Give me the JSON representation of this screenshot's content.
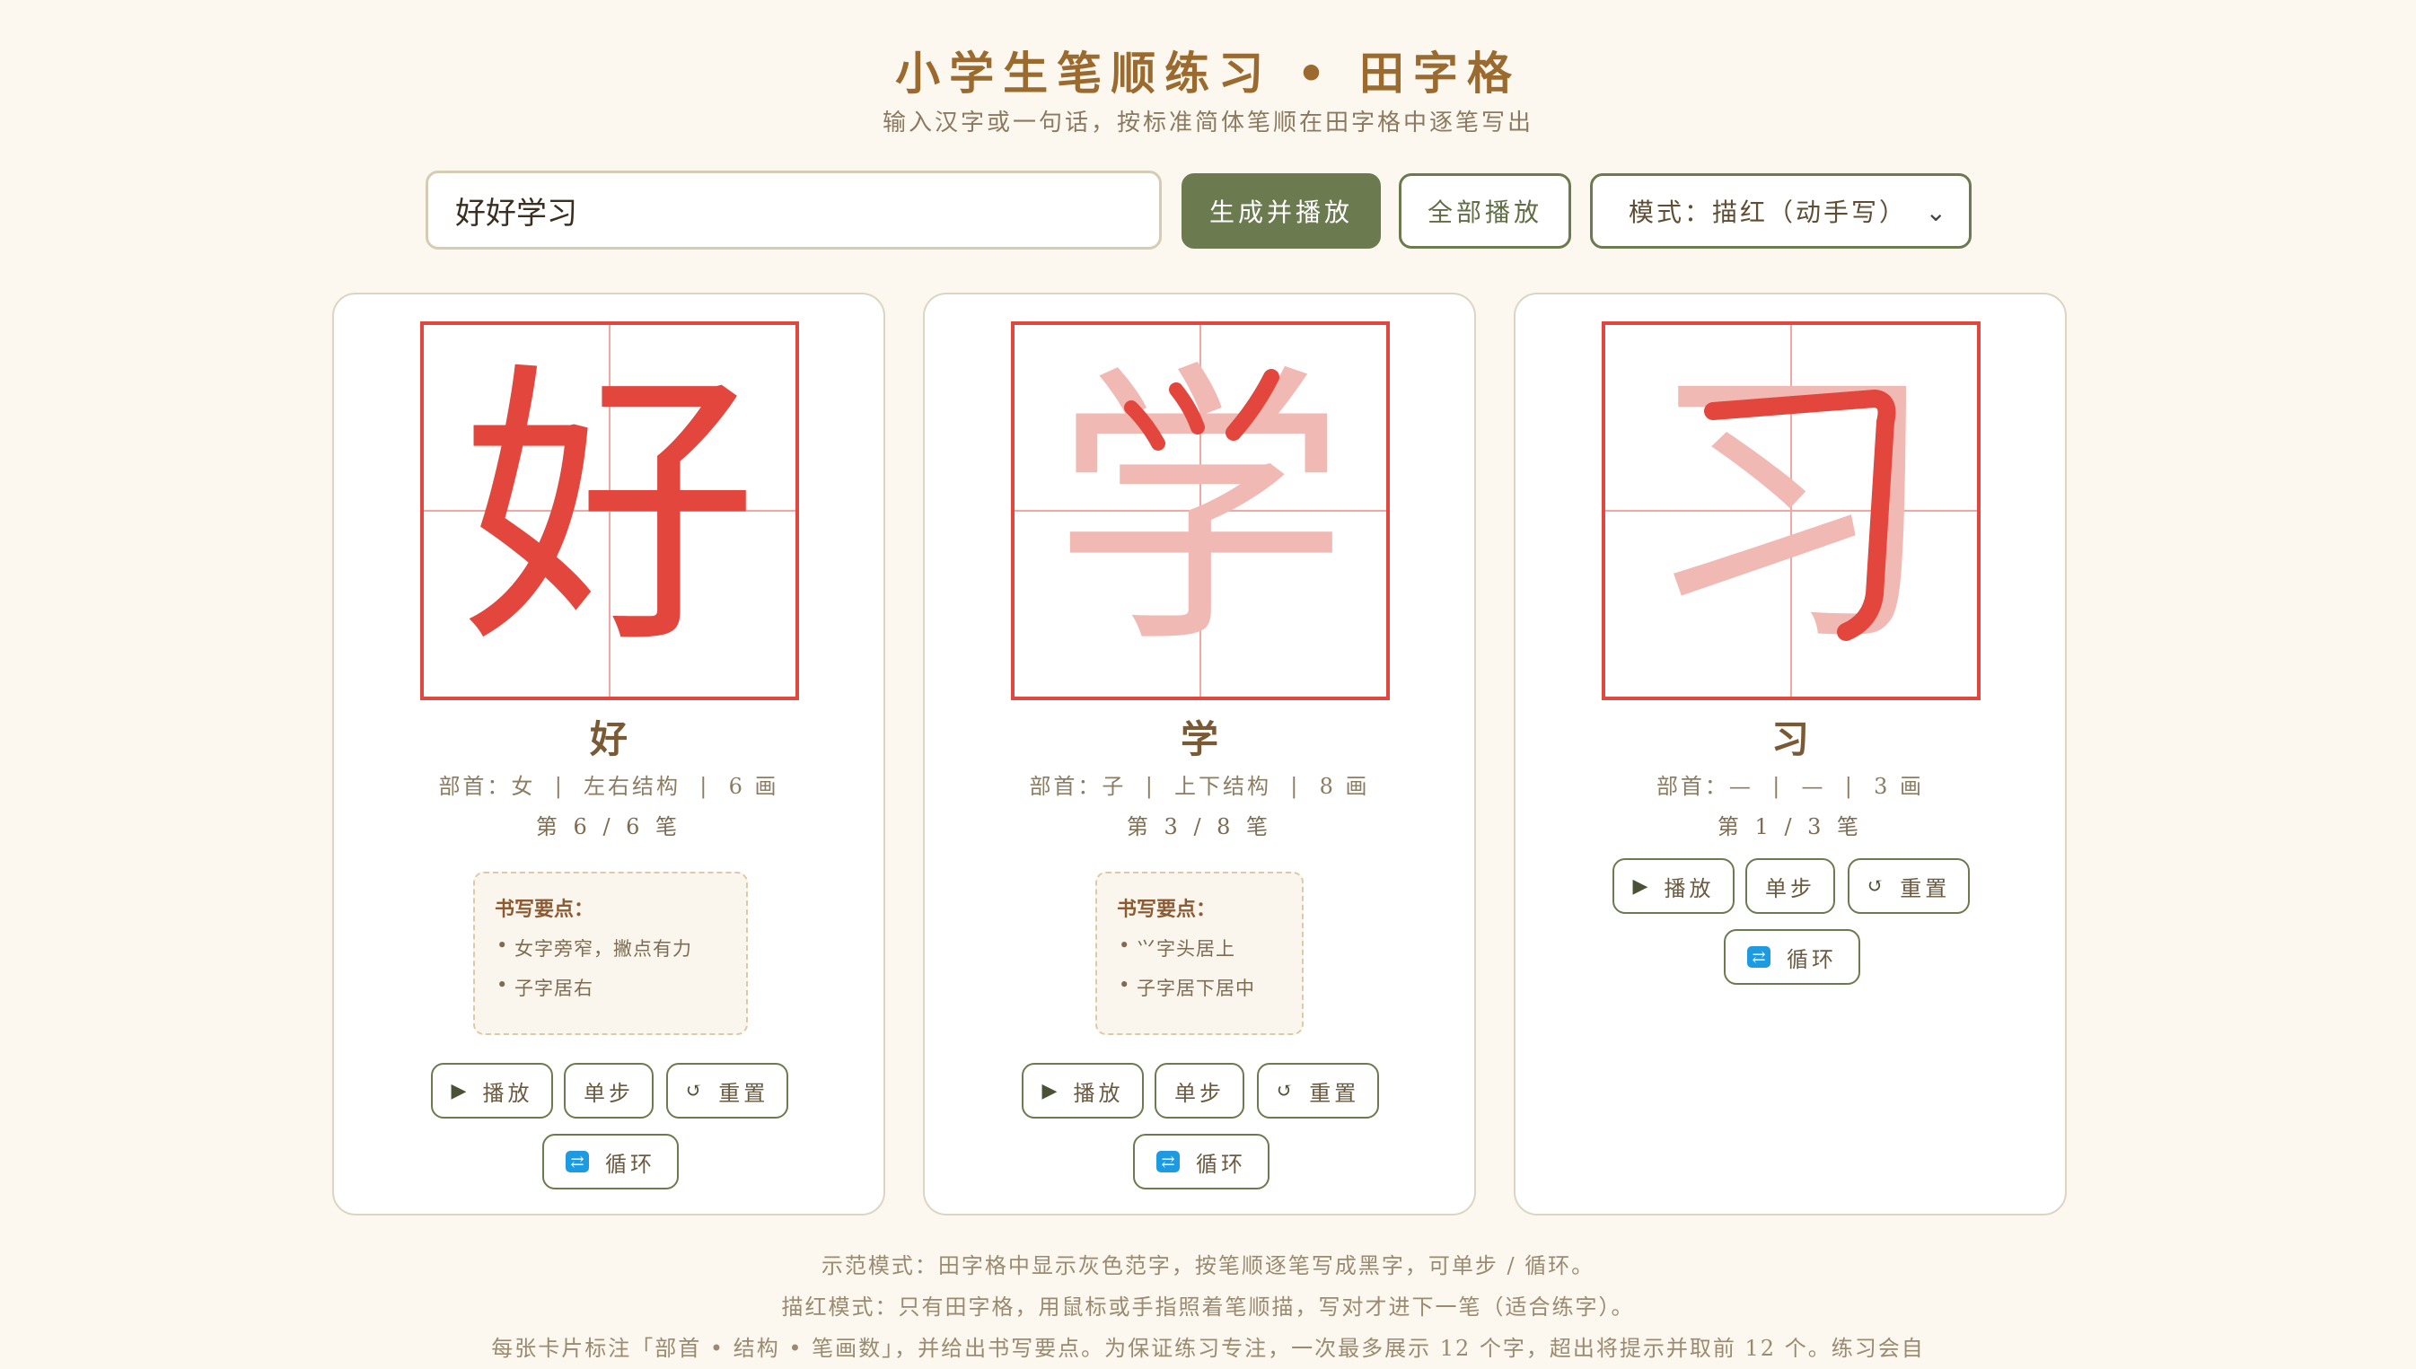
{
  "header": {
    "title": "小学生笔顺练习 • 田字格",
    "subtitle": "输入汉字或一句话，按标准简体笔顺在田字格中逐笔写出"
  },
  "controls": {
    "input_value": "好好学习",
    "generate_label": "生成并播放",
    "play_all_label": "全部播放",
    "mode_label": "模式：描红（动手写）"
  },
  "cards": [
    {
      "char": "好",
      "info": "部首：女  |  左右结构  |  6 画",
      "progress": "第 6 / 6 笔",
      "tips_title": "书写要点：",
      "tips": [
        "女字旁窄，撇点有力",
        "子字居右"
      ],
      "play_label": "播放",
      "step_label": "单步",
      "reset_label": "重置",
      "loop_label": "循环"
    },
    {
      "char": "学",
      "info": "部首：子  |  上下结构  |  8 画",
      "progress": "第 3 / 8 笔",
      "tips_title": "书写要点：",
      "tips": [
        "⺍字头居上",
        "子字居下居中"
      ],
      "play_label": "播放",
      "step_label": "单步",
      "reset_label": "重置",
      "loop_label": "循环"
    },
    {
      "char": "习",
      "info": "部首：—  |  —  |  3 画",
      "progress": "第 1 / 3 笔",
      "play_label": "播放",
      "step_label": "单步",
      "reset_label": "重置",
      "loop_label": "循环"
    }
  ],
  "footer": {
    "line1": "示范模式：田字格中显示灰色范字，按笔顺逐笔写成黑字，可单步 / 循环。",
    "line2": "描红模式：只有田字格，用鼠标或手指照着笔顺描，写对才进下一笔（适合练字）。",
    "line3": "每张卡片标注「部首 • 结构 • 笔画数」，并给出书写要点。为保证练习专注，一次最多展示 12 个字，超出将提示并取前 12 个。练习会自"
  },
  "colors": {
    "grid_border": "#e0483f",
    "stroke_done": "#e2463c",
    "stroke_pending": "#f1b9b3",
    "primary": "#6c7a50",
    "title": "#9b6a2e"
  }
}
